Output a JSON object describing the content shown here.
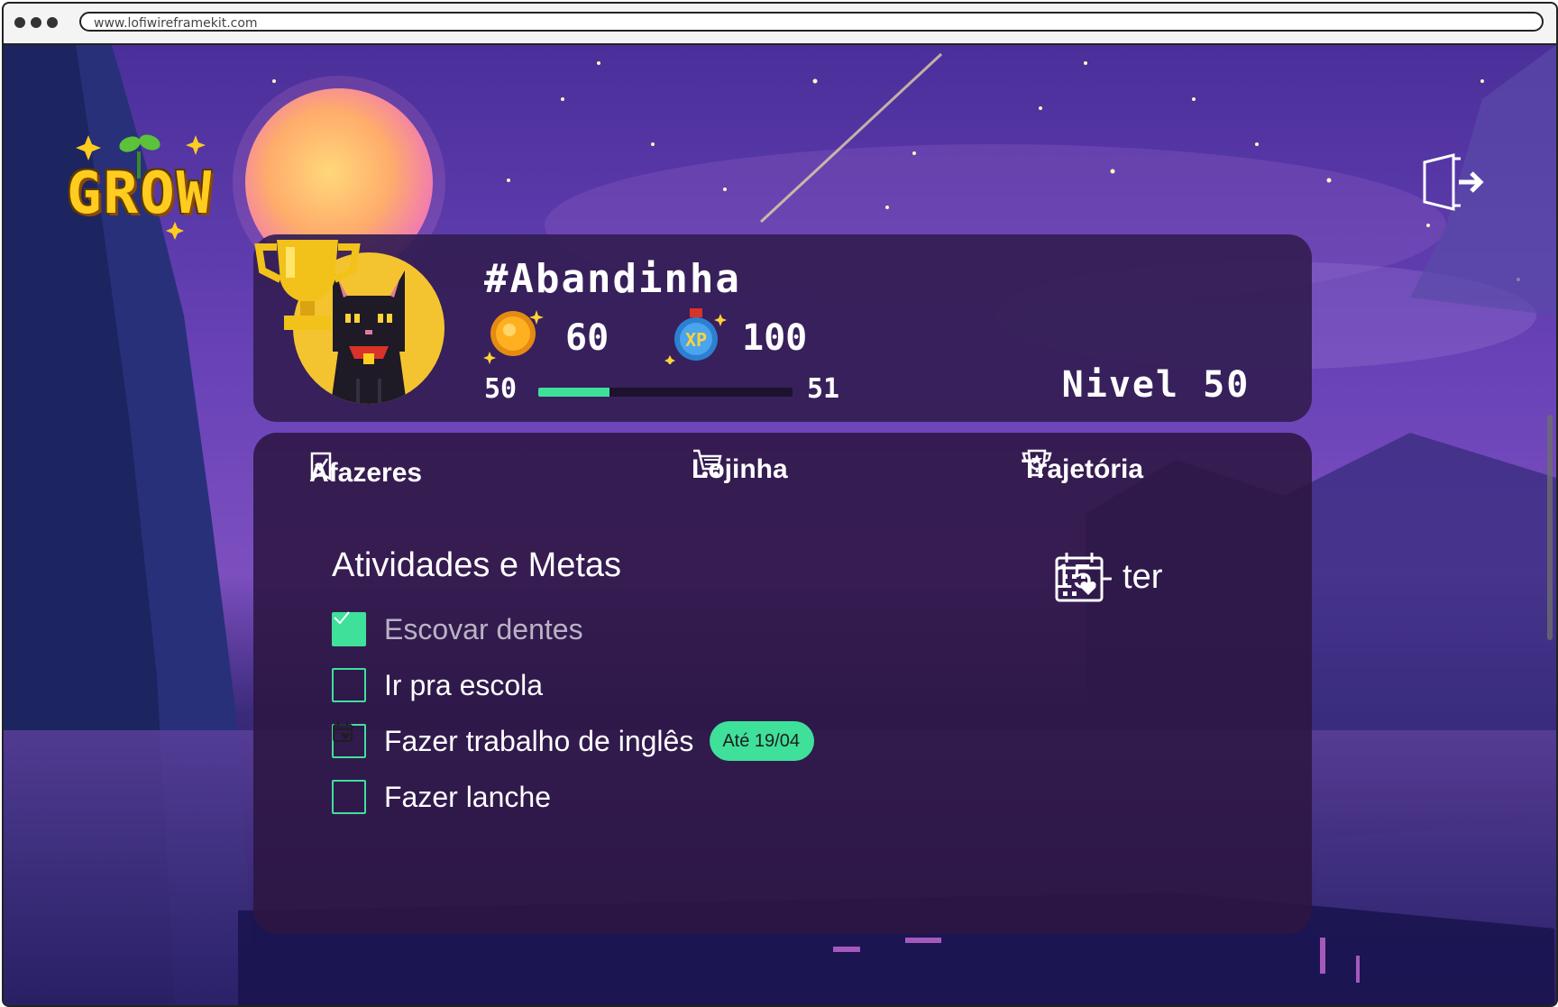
{
  "browser": {
    "url": "www.lofiwireframekit.com"
  },
  "app": {
    "logo_text": "GROW",
    "exit_icon": "exit-door-icon"
  },
  "profile": {
    "username": "#Abandinha",
    "coins": "60",
    "xp": "100",
    "level_current": "50",
    "level_next": "51",
    "level_progress": 0.28,
    "level_label": "Nivel 50",
    "avatar_icon": "black-cat-avatar",
    "coin_icon": "coin-icon",
    "xp_icon": "xp-potion-icon",
    "trophy_icon": "trophy-icon"
  },
  "tabs": [
    {
      "label": "Afazeres",
      "icon": "checklist-icon",
      "active": true
    },
    {
      "label": "Lojinha",
      "icon": "cart-icon",
      "active": false
    },
    {
      "label": "Trajetória",
      "icon": "trophy-star-icon",
      "active": false
    }
  ],
  "section": {
    "title": "Atividades e Metas",
    "date": "15 - ter",
    "date_icon": "calendar-heart-icon"
  },
  "tasks": [
    {
      "label": "Escovar dentes",
      "checked": true
    },
    {
      "label": "Ir pra escola",
      "checked": false
    },
    {
      "label": "Fazer trabalho de inglês",
      "checked": false,
      "deadline": "Até 19/04"
    },
    {
      "label": "Fazer lanche",
      "checked": false
    }
  ],
  "colors": {
    "accent": "#3fe09a",
    "card": "#341e54",
    "logo": "#ffcc1f",
    "avatar_bg": "#f4c430"
  }
}
